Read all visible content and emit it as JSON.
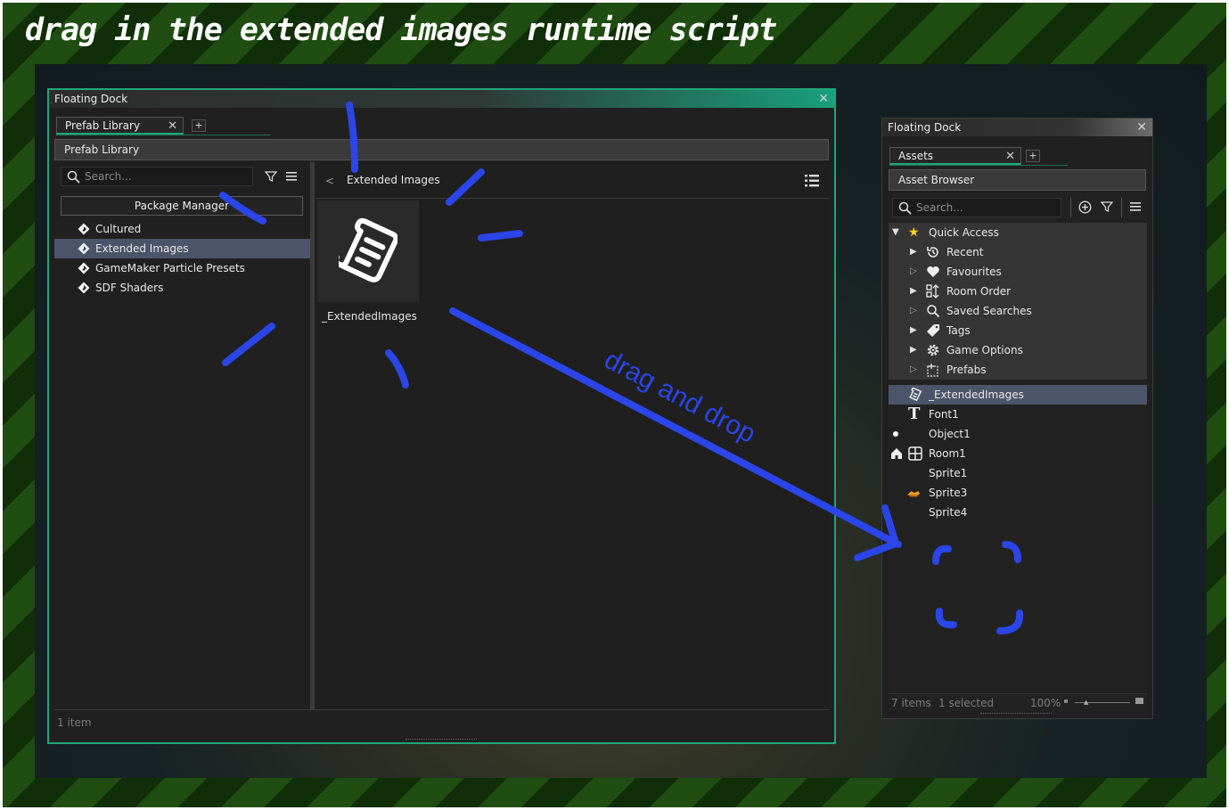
{
  "headline": "drag in the extended images runtime script",
  "annotation": "drag and drop",
  "left_dock": {
    "title": "Floating Dock",
    "tab_label": "Prefab Library",
    "header": "Prefab Library",
    "search_placeholder": "Search...",
    "package_manager_label": "Package Manager",
    "packages": [
      "Cultured",
      "Extended Images",
      "GameMaker Particle Presets",
      "SDF Shaders"
    ],
    "selected_package": "Extended Images",
    "breadcrumb_back": "<",
    "breadcrumb": "Extended Images",
    "tile_label": "_ExtendedImages",
    "status": "1 item"
  },
  "right_dock": {
    "title": "Floating Dock",
    "tab_label": "Assets",
    "header": "Asset Browser",
    "search_placeholder": "Search...",
    "quick_access": {
      "label": "Quick Access",
      "items": [
        {
          "label": "Recent",
          "icon": "history-icon"
        },
        {
          "label": "Favourites",
          "icon": "heart-icon"
        },
        {
          "label": "Room Order",
          "icon": "room-order-icon"
        },
        {
          "label": "Saved Searches",
          "icon": "search-icon"
        },
        {
          "label": "Tags",
          "icon": "tag-icon"
        },
        {
          "label": "Game Options",
          "icon": "gear-icon"
        },
        {
          "label": "Prefabs",
          "icon": "prefab-icon"
        }
      ]
    },
    "assets": [
      {
        "label": "_ExtendedImages",
        "icon": "script-icon"
      },
      {
        "label": "Font1",
        "icon": "font-icon"
      },
      {
        "label": "Object1",
        "icon": "object-icon"
      },
      {
        "label": "Room1",
        "icon": "room-icon"
      },
      {
        "label": "Sprite1",
        "icon": "sprite-icon"
      },
      {
        "label": "Sprite3",
        "icon": "sprite-icon"
      },
      {
        "label": "Sprite4",
        "icon": "sprite-icon"
      }
    ],
    "status_count": "7 items",
    "status_selected": "1 selected",
    "zoom": "100%"
  },
  "colors": {
    "accent": "#1fa67a",
    "selection": "#4b5468",
    "annotation": "#2b45e8"
  }
}
